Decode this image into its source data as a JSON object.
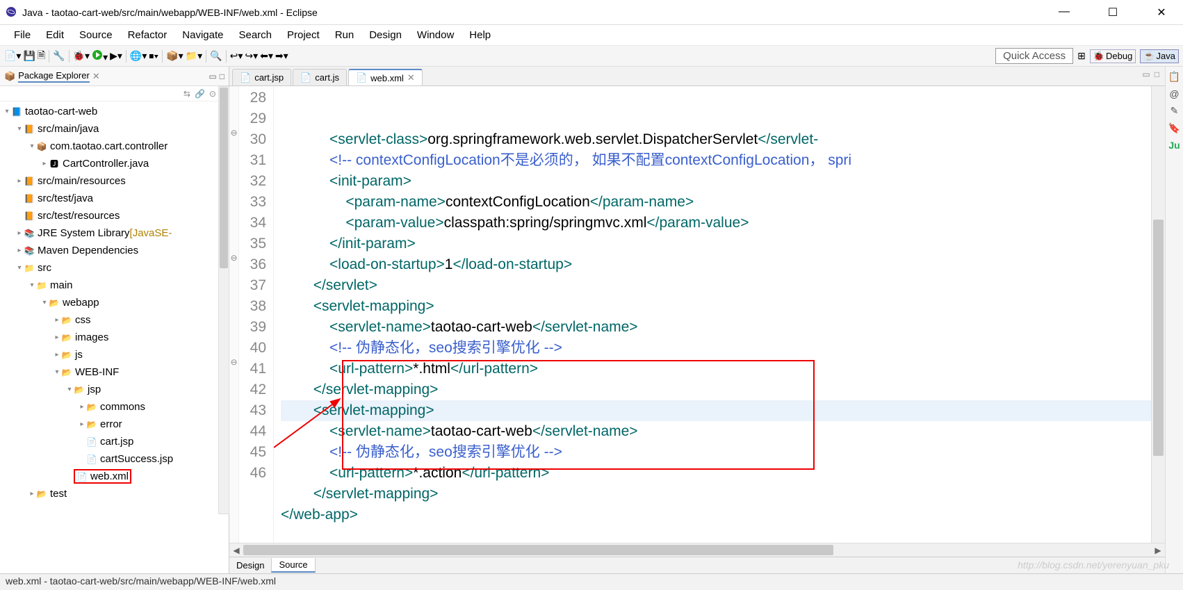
{
  "title": "Java - taotao-cart-web/src/main/webapp/WEB-INF/web.xml - Eclipse",
  "menubar": [
    "File",
    "Edit",
    "Source",
    "Refactor",
    "Navigate",
    "Search",
    "Project",
    "Run",
    "Design",
    "Window",
    "Help"
  ],
  "toolbar": {
    "quick_access": "Quick Access",
    "perspectives": [
      "Debug",
      "Java"
    ]
  },
  "views": {
    "package_explorer": {
      "title": "Package Explorer"
    }
  },
  "tree": [
    {
      "ind": 0,
      "exp": "▾",
      "icon": "proj",
      "label": "taotao-cart-web"
    },
    {
      "ind": 1,
      "exp": "▾",
      "icon": "pkg-src",
      "label": "src/main/java"
    },
    {
      "ind": 2,
      "exp": "▾",
      "icon": "pkg",
      "label": "com.taotao.cart.controller"
    },
    {
      "ind": 3,
      "exp": "▸",
      "icon": "java",
      "label": "CartController.java"
    },
    {
      "ind": 1,
      "exp": "▸",
      "icon": "pkg-src",
      "label": "src/main/resources"
    },
    {
      "ind": 1,
      "exp": "",
      "icon": "pkg-src",
      "label": "src/test/java"
    },
    {
      "ind": 1,
      "exp": "",
      "icon": "pkg-src",
      "label": "src/test/resources"
    },
    {
      "ind": 1,
      "exp": "▸",
      "icon": "lib",
      "label": "JRE System Library ",
      "decor": "[JavaSE-"
    },
    {
      "ind": 1,
      "exp": "▸",
      "icon": "lib",
      "label": "Maven Dependencies"
    },
    {
      "ind": 1,
      "exp": "▾",
      "icon": "folder",
      "label": "src"
    },
    {
      "ind": 2,
      "exp": "▾",
      "icon": "folder",
      "label": "main"
    },
    {
      "ind": 3,
      "exp": "▾",
      "icon": "folder-o",
      "label": "webapp"
    },
    {
      "ind": 4,
      "exp": "▸",
      "icon": "folder-o",
      "label": "css"
    },
    {
      "ind": 4,
      "exp": "▸",
      "icon": "folder-o",
      "label": "images"
    },
    {
      "ind": 4,
      "exp": "▸",
      "icon": "folder-o",
      "label": "js"
    },
    {
      "ind": 4,
      "exp": "▾",
      "icon": "folder-o",
      "label": "WEB-INF"
    },
    {
      "ind": 5,
      "exp": "▾",
      "icon": "folder-o",
      "label": "jsp"
    },
    {
      "ind": 6,
      "exp": "▸",
      "icon": "folder-o",
      "label": "commons"
    },
    {
      "ind": 6,
      "exp": "▸",
      "icon": "folder-o",
      "label": "error"
    },
    {
      "ind": 6,
      "exp": "",
      "icon": "jsp",
      "label": "cart.jsp"
    },
    {
      "ind": 6,
      "exp": "",
      "icon": "jsp",
      "label": "cartSuccess.jsp"
    },
    {
      "ind": 5,
      "exp": "",
      "icon": "xml",
      "label": "web.xml",
      "boxed": true
    },
    {
      "ind": 2,
      "exp": "▸",
      "icon": "folder-o",
      "label": "test"
    }
  ],
  "tabs": [
    {
      "label": "cart.jsp",
      "icon": "jsp"
    },
    {
      "label": "cart.js",
      "icon": "js"
    },
    {
      "label": "web.xml",
      "icon": "xml",
      "active": true
    }
  ],
  "bottom_tabs": [
    "Design",
    "Source"
  ],
  "gutter": [
    "28",
    "29",
    "30",
    "31",
    "32",
    "33",
    "34",
    "35",
    "36",
    "37",
    "38",
    "39",
    "40",
    "41",
    "42",
    "43",
    "44",
    "45",
    "46"
  ],
  "fold_markers": {
    "30": "⊖",
    "36": "⊖",
    "41": "⊖"
  },
  "code": [
    [
      [
        "            ",
        ""
      ],
      [
        "<servlet-class>",
        "tag"
      ],
      [
        "org.springframework.web.servlet.DispatcherServlet",
        "text"
      ],
      [
        "</servlet-",
        "tag"
      ]
    ],
    [
      [
        "            ",
        ""
      ],
      [
        "<!-- contextConfigLocation不是必须的， 如果不配置contextConfigLocation， spri",
        "cmt"
      ]
    ],
    [
      [
        "            ",
        ""
      ],
      [
        "<init-param>",
        "tag"
      ]
    ],
    [
      [
        "                ",
        ""
      ],
      [
        "<param-name>",
        "tag"
      ],
      [
        "contextConfigLocation",
        "text"
      ],
      [
        "</param-name>",
        "tag"
      ]
    ],
    [
      [
        "                ",
        ""
      ],
      [
        "<param-value>",
        "tag"
      ],
      [
        "classpath:spring/springmvc.xml",
        "text"
      ],
      [
        "</param-value>",
        "tag"
      ]
    ],
    [
      [
        "            ",
        ""
      ],
      [
        "</init-param>",
        "tag"
      ]
    ],
    [
      [
        "            ",
        ""
      ],
      [
        "<load-on-startup>",
        "tag"
      ],
      [
        "1",
        "text"
      ],
      [
        "</load-on-startup>",
        "tag"
      ]
    ],
    [
      [
        "        ",
        ""
      ],
      [
        "</servlet>",
        "tag"
      ]
    ],
    [
      [
        "        ",
        ""
      ],
      [
        "<servlet-mapping>",
        "tag"
      ]
    ],
    [
      [
        "            ",
        ""
      ],
      [
        "<servlet-name>",
        "tag"
      ],
      [
        "taotao-cart-web",
        "text"
      ],
      [
        "</servlet-name>",
        "tag"
      ]
    ],
    [
      [
        "            ",
        ""
      ],
      [
        "<!-- 伪静态化，seo搜索引擎优化 -->",
        "cmt"
      ]
    ],
    [
      [
        "            ",
        ""
      ],
      [
        "<url-pattern>",
        "tag"
      ],
      [
        "*.html",
        "text"
      ],
      [
        "</url-pattern>",
        "tag"
      ]
    ],
    [
      [
        "        ",
        ""
      ],
      [
        "</servlet-mapping>",
        "tag"
      ]
    ],
    [
      [
        "        ",
        ""
      ],
      [
        "<servlet-mapping>",
        "tag"
      ]
    ],
    [
      [
        "            ",
        ""
      ],
      [
        "<servlet-name>",
        "tag"
      ],
      [
        "taotao-cart-web",
        "text"
      ],
      [
        "</servlet-name>",
        "tag"
      ]
    ],
    [
      [
        "            ",
        ""
      ],
      [
        "<!-- 伪静态化，seo搜索引擎优化 -->",
        "cmt"
      ]
    ],
    [
      [
        "            ",
        ""
      ],
      [
        "<url-pattern>",
        "tag"
      ],
      [
        "*.action",
        "text"
      ],
      [
        "</url-pattern>",
        "tag"
      ]
    ],
    [
      [
        "        ",
        ""
      ],
      [
        "</servlet-mapping>",
        "tag"
      ]
    ],
    [
      [
        "</web-app>",
        "tag"
      ]
    ]
  ],
  "current_line_index": 13,
  "status": "web.xml - taotao-cart-web/src/main/webapp/WEB-INF/web.xml",
  "watermark": "http://blog.csdn.net/yerenyuan_pku"
}
